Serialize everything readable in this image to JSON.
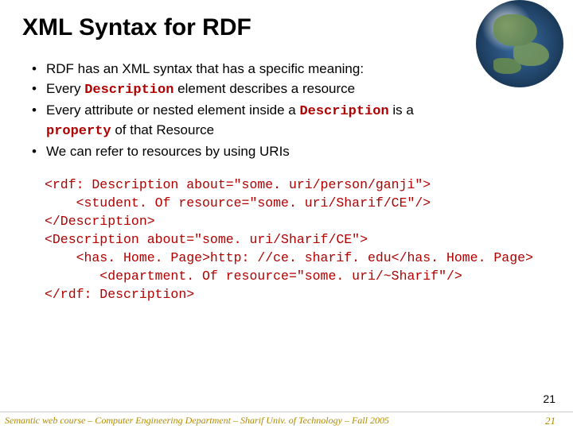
{
  "title": "XML Syntax for RDF",
  "bullets": [
    {
      "pre": "RDF has an XML syntax that has a specific meaning:",
      "kw": "",
      "post": ""
    },
    {
      "pre": "Every ",
      "kw": "Description",
      "post": " element describes a resource"
    },
    {
      "pre": "Every attribute or nested element inside a ",
      "kw": "Description",
      "post": " is a "
    },
    {
      "pre": "",
      "kw": "property",
      "post": " of that Resource",
      "cont": true
    },
    {
      "pre": "We can refer to resources by using URIs",
      "kw": "",
      "post": ""
    }
  ],
  "code": "<rdf: Description about=\"some. uri/person/ganji\">\n    <student. Of resource=\"some. uri/Sharif/CE\"/>\n</Description>\n<Description about=\"some. uri/Sharif/CE\">\n    <has. Home. Page>http: //ce. sharif. edu</has. Home. Page>\n       <department. Of resource=\"some. uri/~Sharif\"/>\n</rdf: Description>",
  "pagenum": "21",
  "footer": "Semantic web course – Computer Engineering Department – Sharif Univ. of Technology – Fall 2005",
  "footer_num": "21"
}
